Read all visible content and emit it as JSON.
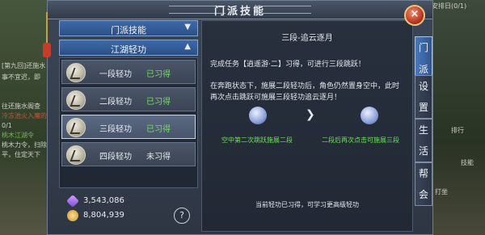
{
  "window": {
    "title": "门派技能",
    "close_symbol": "×"
  },
  "categories": [
    {
      "label": "门派技能",
      "chevron": "▼"
    },
    {
      "label": "江湖轻功",
      "chevron": "▲"
    }
  ],
  "skills": [
    {
      "name": "一段轻功",
      "status": "已习得",
      "learned": true
    },
    {
      "name": "二段轻功",
      "status": "已习得",
      "learned": true
    },
    {
      "name": "三段轻功",
      "status": "已习得",
      "learned": true,
      "selected": true
    },
    {
      "name": "四段轻功",
      "status": "未习得",
      "learned": false
    }
  ],
  "currency": [
    {
      "icon": "gem-icon",
      "amount": "3,543,086"
    },
    {
      "icon": "coin-icon",
      "amount": "8,804,939"
    }
  ],
  "help_symbol": "?",
  "detail": {
    "title": "三段-追云逐月",
    "requirement": "完成任务【逍遥游·二】习得，可进行三段跳跃！",
    "description": "在奔跑状态下，施展二段轻功后，角色仍然置身空中，此时再次点击跳跃可施展三段轻功追云逐月！",
    "arrow": "❯",
    "caption_left": "空中第二次跳跃施展二段",
    "caption_right": "二段后再次点击可施展三段",
    "footer": "当前轻功已习得，可学习更高级轻功"
  },
  "side_tabs": [
    {
      "label": "门派",
      "active": true
    },
    {
      "label": "设置",
      "active": false
    },
    {
      "label": "生活",
      "active": false
    },
    {
      "label": "帮会",
      "active": false
    }
  ],
  "background": {
    "left_lines": [
      "事不宜迟，即",
      "往还施水阁查",
      "0/1",
      "桃木力令，扫除",
      "平，住定天下"
    ],
    "left_quest_title": "[第九回]还施水",
    "left_quest_title_2": "桃木江湖令",
    "left_red": "冷冻池火入魔的",
    "right_top": "安排日(0/1)",
    "right_labels": [
      "排行",
      "技能",
      "打坐"
    ]
  },
  "colors": {
    "learned": "#6ee05a",
    "not_learned": "#e6e6e6",
    "tab_active": "#3e6aa8",
    "close_button": "#b02a1a"
  }
}
